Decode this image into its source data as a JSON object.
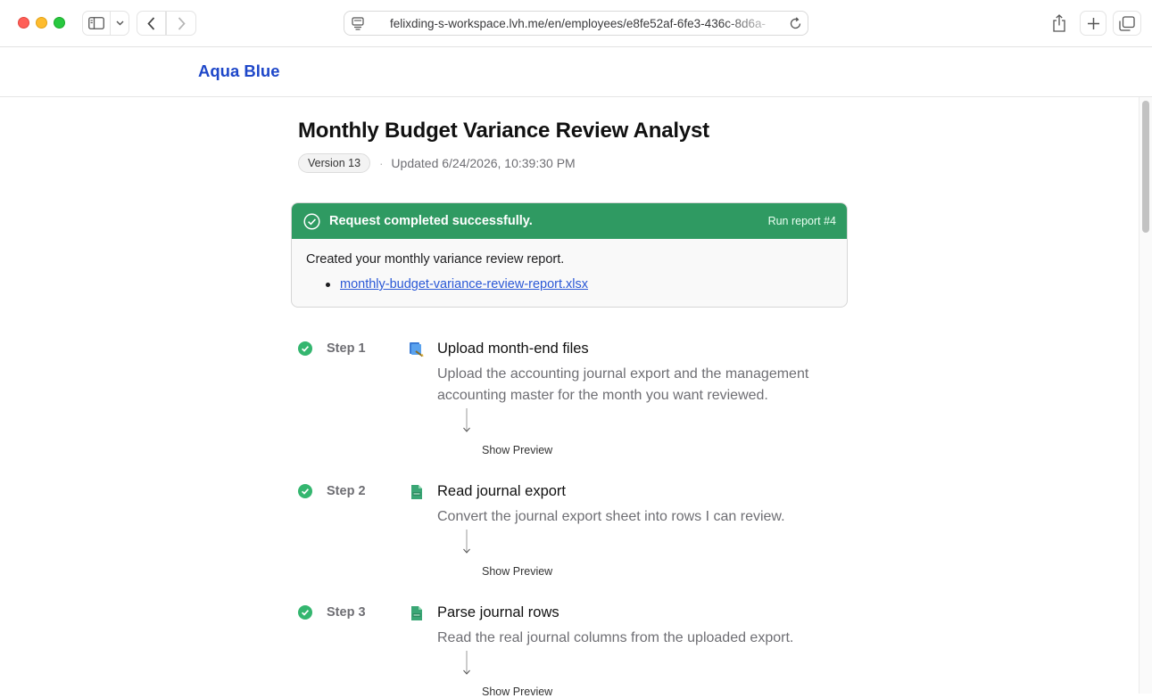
{
  "browser": {
    "url": "felixding-s-workspace.lvh.me/en/employees/e8fe52af-6fe3-436c-8d6a-"
  },
  "app": {
    "brand": "Aqua Blue"
  },
  "page": {
    "title": "Monthly Budget Variance Review Analyst",
    "version": "Version 13",
    "separator": "·",
    "updated": "Updated 6/24/2026, 10:39:30 PM"
  },
  "result": {
    "status": "Request completed successfully.",
    "run_report": "Run report #4",
    "message": "Created your monthly variance review report.",
    "files": [
      "monthly-budget-variance-review-report.xlsx"
    ],
    "accent_color": "#2f9a62"
  },
  "steps": [
    {
      "label": "Step 1",
      "icon": "upload-files-icon",
      "title": "Upload month-end files",
      "description": "Upload the accounting journal export and the management accounting master for the month you want reviewed.",
      "preview": "Show Preview"
    },
    {
      "label": "Step 2",
      "icon": "csv-file-icon",
      "title": "Read journal export",
      "description": "Convert the journal export sheet into rows I can review.",
      "preview": "Show Preview"
    },
    {
      "label": "Step 3",
      "icon": "csv-file-icon",
      "title": "Parse journal rows",
      "description": "Read the real journal columns from the uploaded export.",
      "preview": "Show Preview"
    }
  ]
}
